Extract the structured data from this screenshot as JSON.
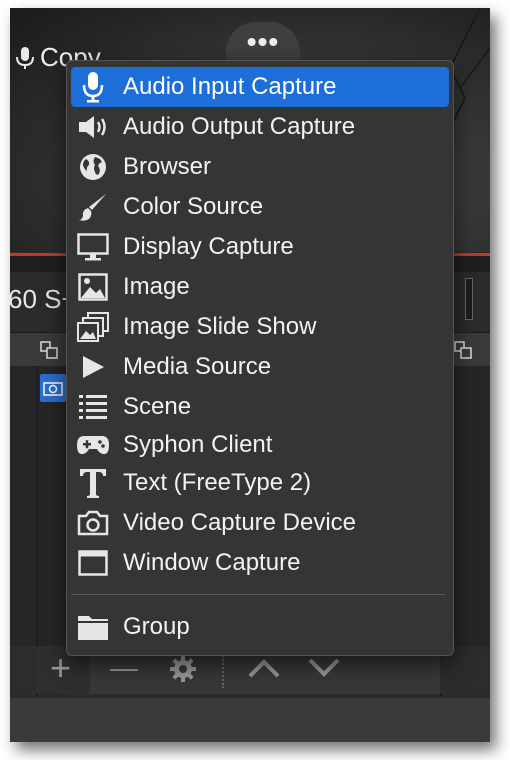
{
  "app": {
    "preview_label": "Copy",
    "preview_more": "•••",
    "status_fragment": "60 S+"
  },
  "toolbar": {
    "add": "+",
    "remove": "—",
    "up": "∧",
    "down": "∨"
  },
  "menu": {
    "items": [
      {
        "label": "Audio Input Capture",
        "icon": "microphone-icon",
        "selected": true
      },
      {
        "label": "Audio Output Capture",
        "icon": "speaker-icon",
        "selected": false
      },
      {
        "label": "Browser",
        "icon": "globe-icon",
        "selected": false
      },
      {
        "label": "Color Source",
        "icon": "paintbrush-icon",
        "selected": false
      },
      {
        "label": "Display Capture",
        "icon": "monitor-icon",
        "selected": false
      },
      {
        "label": "Image",
        "icon": "image-icon",
        "selected": false
      },
      {
        "label": "Image Slide Show",
        "icon": "image-stack-icon",
        "selected": false
      },
      {
        "label": "Media Source",
        "icon": "play-icon",
        "selected": false
      },
      {
        "label": "Scene",
        "icon": "list-icon",
        "selected": false
      },
      {
        "label": "Syphon Client",
        "icon": "gamepad-icon",
        "selected": false
      },
      {
        "label": "Text (FreeType 2)",
        "icon": "text-icon",
        "selected": false
      },
      {
        "label": "Video Capture Device",
        "icon": "camera-icon",
        "selected": false
      },
      {
        "label": "Window Capture",
        "icon": "window-icon",
        "selected": false
      },
      {
        "label": "Group",
        "icon": "folder-icon",
        "selected": false
      }
    ]
  },
  "colors": {
    "selection": "#1d6ed8",
    "menu_bg": "#353535",
    "accent_red": "#c0392b"
  }
}
